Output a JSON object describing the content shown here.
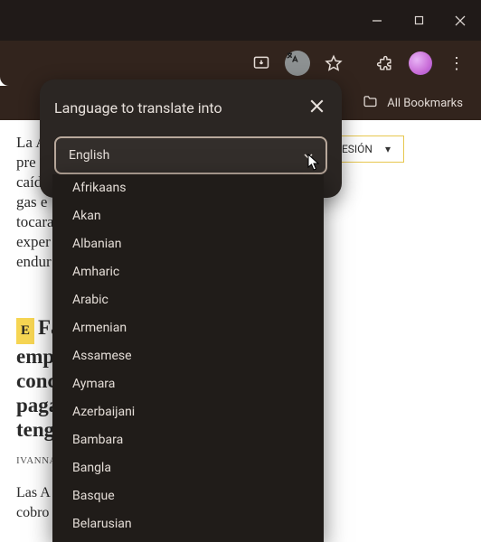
{
  "window": {
    "minimize": "—",
    "maximize": "□",
    "close": "✕"
  },
  "bookmarks": {
    "all_label": "All Bookmarks"
  },
  "sesion": {
    "label": "ESIÓN",
    "arrow": "▾"
  },
  "article1": {
    "l1": "La A",
    "l2": "pre",
    "l3": "caíd",
    "l4": "gas e",
    "l5": "tocara",
    "l6": "exper",
    "l7": "endur"
  },
  "article2": {
    "badge": "E",
    "h1": "Fa",
    "h2": "emp",
    "h3": "conc",
    "h4": "paga",
    "h5": "teng",
    "byline": "IVANNA V",
    "b1": "Las A",
    "b2": "cobro"
  },
  "popup": {
    "title": "Language to translate into",
    "selected": "English"
  },
  "languages": [
    "Afrikaans",
    "Akan",
    "Albanian",
    "Amharic",
    "Arabic",
    "Armenian",
    "Assamese",
    "Aymara",
    "Azerbaijani",
    "Bambara",
    "Bangla",
    "Basque",
    "Belarusian"
  ]
}
